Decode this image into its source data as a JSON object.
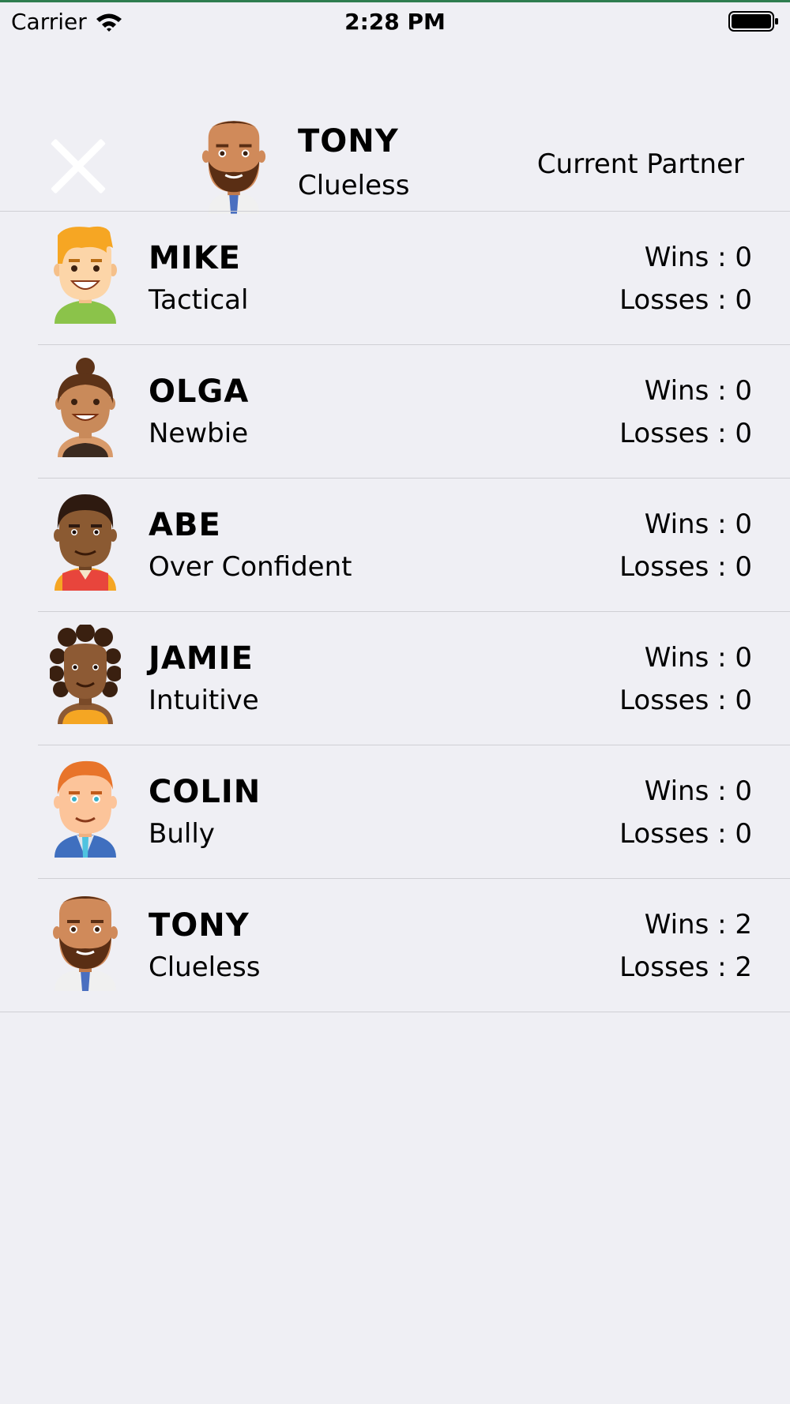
{
  "status_bar": {
    "carrier": "Carrier",
    "time": "2:28 PM"
  },
  "header": {
    "close_icon": "close-icon",
    "partner_name": "TONY",
    "partner_trait": "Clueless",
    "partner_label": "Current Partner"
  },
  "players": [
    {
      "name": "MIKE",
      "trait": "Tactical",
      "wins_label": "Wins : 0",
      "losses_label": "Losses : 0",
      "hair": "#f6a623",
      "skin": "#fcd5a8",
      "shirt": "#8bc34a"
    },
    {
      "name": "OLGA",
      "trait": "Newbie",
      "wins_label": "Wins : 0",
      "losses_label": "Losses : 0",
      "hair": "#5d3318",
      "skin": "#c98a5a",
      "shirt": "#3b2a20"
    },
    {
      "name": "ABE",
      "trait": "Over Confident",
      "wins_label": "Wins : 0",
      "losses_label": "Losses : 0",
      "hair": "#2e1a10",
      "skin": "#8b5a32",
      "shirt": "#e8453c"
    },
    {
      "name": "JAMIE",
      "trait": "Intuitive",
      "wins_label": "Wins : 0",
      "losses_label": "Losses : 0",
      "hair": "#3a2010",
      "skin": "#8d5a34",
      "shirt": "#f5a623"
    },
    {
      "name": "COLIN",
      "trait": "Bully",
      "wins_label": "Wins : 0",
      "losses_label": "Losses : 0",
      "hair": "#e8742a",
      "skin": "#fcc49a",
      "shirt": "#3f6fbf"
    },
    {
      "name": "TONY",
      "trait": "Clueless",
      "wins_label": "Wins : 2",
      "losses_label": "Losses : 2",
      "hair": "#5a2e14",
      "skin": "#d08a5a",
      "shirt": "#f0f0f0"
    }
  ]
}
